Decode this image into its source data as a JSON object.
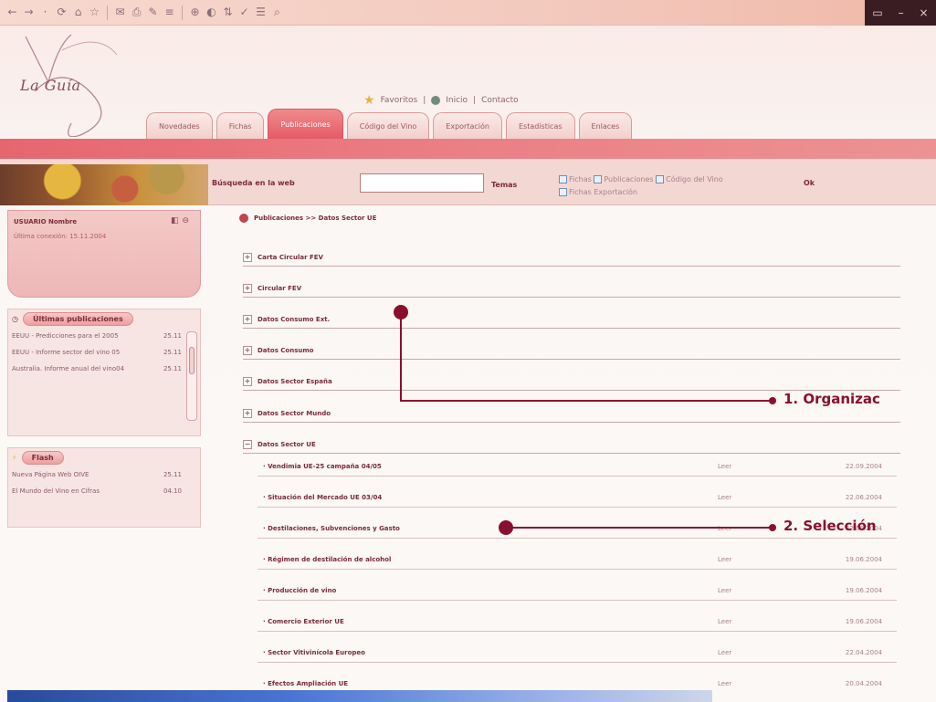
{
  "toolbar": {
    "icons": [
      "←",
      "→",
      "·",
      "⟳",
      "⌂",
      "☆",
      "✉",
      "⎙",
      "✎",
      "≡",
      "⊕",
      "◐",
      "⇅",
      "✓",
      "☰",
      "⌕"
    ],
    "window_controls": [
      "▭",
      "–",
      "×"
    ]
  },
  "logo": {
    "text": "La Guía"
  },
  "top_links": {
    "favoritos": "Favoritos",
    "inicio": "Inicio",
    "contacto": "Contacto"
  },
  "tabs": [
    "Novedades",
    "Fichas",
    "Publicaciones",
    "Código del Vino",
    "Exportación",
    "Estadísticas",
    "Enlaces"
  ],
  "search": {
    "label": "Búsqueda en la web",
    "temas": "Temas",
    "checks": [
      "Fichas",
      "Publicaciones",
      "Código del Vino",
      "Fichas Exportación"
    ],
    "ok": "Ok"
  },
  "user": {
    "name": "USUARIO Nombre",
    "last_visit": "Última conexión: 15.11.2004"
  },
  "last_pubs": {
    "title": "Últimas publicaciones",
    "items": [
      {
        "text": "EEUU - Predicciones para el 2005",
        "date": "25.11"
      },
      {
        "text": "EEUU - Informe sector del vino 05",
        "date": "25.11"
      },
      {
        "text": "Australia. Informe anual del vino04",
        "date": "25.11"
      }
    ]
  },
  "flash": {
    "title": "Flash",
    "items": [
      {
        "text": "Nueva Página Web OIVE",
        "date": "25.11"
      },
      {
        "text": "El Mundo del Vino en Cifras",
        "date": "04.10"
      }
    ]
  },
  "breadcrumb": "Publicaciones >> Datos Sector UE",
  "categories": [
    {
      "label": "Carta Circular FEV",
      "sign": "+"
    },
    {
      "label": "Circular FEV",
      "sign": "+"
    },
    {
      "label": "Datos Consumo Ext.",
      "sign": "+"
    },
    {
      "label": "Datos Consumo",
      "sign": "+"
    },
    {
      "label": "Datos Sector España",
      "sign": "+"
    },
    {
      "label": "Datos Sector Mundo",
      "sign": "+"
    },
    {
      "label": "Datos Sector UE",
      "sign": "−"
    }
  ],
  "rows": [
    {
      "title": "· Vendimia UE-25 campaña 04/05",
      "link": "Leer",
      "date": "22.09.2004"
    },
    {
      "title": "· Situación del Mercado UE 03/04",
      "link": "Leer",
      "date": "22.06.2004"
    },
    {
      "title": "· Destilaciones, Subvenciones y Gasto",
      "link": "Leer",
      "date": "22.06.2004"
    },
    {
      "title": "· Régimen de destilación de alcohol",
      "link": "Leer",
      "date": "19.06.2004"
    },
    {
      "title": "· Producción de vino",
      "link": "Leer",
      "date": "19.06.2004"
    },
    {
      "title": "· Comercio Exterior UE",
      "link": "Leer",
      "date": "19.06.2004"
    },
    {
      "title": "· Sector Vitivinícola Europeo",
      "link": "Leer",
      "date": "22.04.2004"
    },
    {
      "title": "· Efectos Ampliación UE",
      "link": "Leer",
      "date": "20.04.2004"
    }
  ],
  "callouts": [
    "1. Organizac",
    "2. Selección"
  ]
}
